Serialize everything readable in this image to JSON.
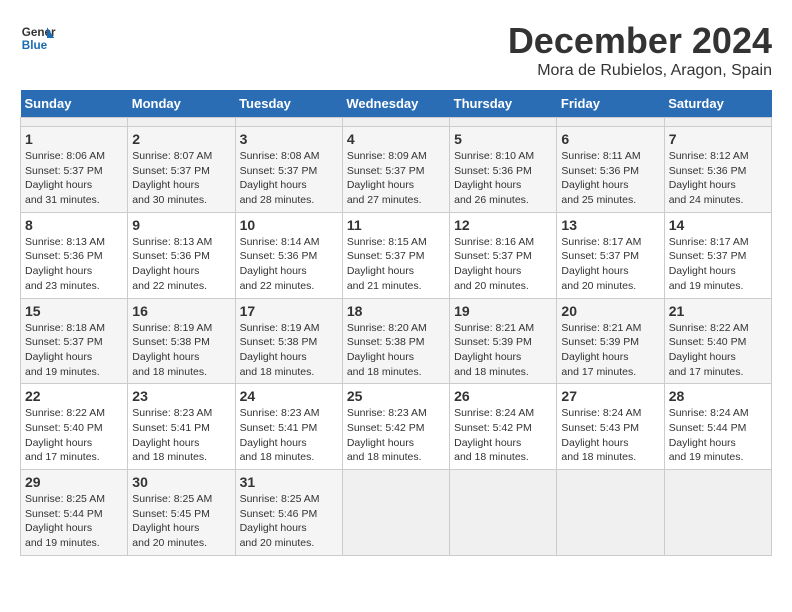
{
  "header": {
    "logo_line1": "General",
    "logo_line2": "Blue",
    "title": "December 2024",
    "subtitle": "Mora de Rubielos, Aragon, Spain"
  },
  "calendar": {
    "days_of_week": [
      "Sunday",
      "Monday",
      "Tuesday",
      "Wednesday",
      "Thursday",
      "Friday",
      "Saturday"
    ],
    "weeks": [
      [
        null,
        null,
        null,
        null,
        null,
        null,
        null
      ],
      [
        {
          "day": 1,
          "sunrise": "8:06 AM",
          "sunset": "5:37 PM",
          "daylight": "9 hours and 31 minutes."
        },
        {
          "day": 2,
          "sunrise": "8:07 AM",
          "sunset": "5:37 PM",
          "daylight": "9 hours and 30 minutes."
        },
        {
          "day": 3,
          "sunrise": "8:08 AM",
          "sunset": "5:37 PM",
          "daylight": "9 hours and 28 minutes."
        },
        {
          "day": 4,
          "sunrise": "8:09 AM",
          "sunset": "5:37 PM",
          "daylight": "9 hours and 27 minutes."
        },
        {
          "day": 5,
          "sunrise": "8:10 AM",
          "sunset": "5:36 PM",
          "daylight": "9 hours and 26 minutes."
        },
        {
          "day": 6,
          "sunrise": "8:11 AM",
          "sunset": "5:36 PM",
          "daylight": "9 hours and 25 minutes."
        },
        {
          "day": 7,
          "sunrise": "8:12 AM",
          "sunset": "5:36 PM",
          "daylight": "9 hours and 24 minutes."
        }
      ],
      [
        {
          "day": 8,
          "sunrise": "8:13 AM",
          "sunset": "5:36 PM",
          "daylight": "9 hours and 23 minutes."
        },
        {
          "day": 9,
          "sunrise": "8:13 AM",
          "sunset": "5:36 PM",
          "daylight": "9 hours and 22 minutes."
        },
        {
          "day": 10,
          "sunrise": "8:14 AM",
          "sunset": "5:36 PM",
          "daylight": "9 hours and 22 minutes."
        },
        {
          "day": 11,
          "sunrise": "8:15 AM",
          "sunset": "5:37 PM",
          "daylight": "9 hours and 21 minutes."
        },
        {
          "day": 12,
          "sunrise": "8:16 AM",
          "sunset": "5:37 PM",
          "daylight": "9 hours and 20 minutes."
        },
        {
          "day": 13,
          "sunrise": "8:17 AM",
          "sunset": "5:37 PM",
          "daylight": "9 hours and 20 minutes."
        },
        {
          "day": 14,
          "sunrise": "8:17 AM",
          "sunset": "5:37 PM",
          "daylight": "9 hours and 19 minutes."
        }
      ],
      [
        {
          "day": 15,
          "sunrise": "8:18 AM",
          "sunset": "5:37 PM",
          "daylight": "9 hours and 19 minutes."
        },
        {
          "day": 16,
          "sunrise": "8:19 AM",
          "sunset": "5:38 PM",
          "daylight": "9 hours and 18 minutes."
        },
        {
          "day": 17,
          "sunrise": "8:19 AM",
          "sunset": "5:38 PM",
          "daylight": "9 hours and 18 minutes."
        },
        {
          "day": 18,
          "sunrise": "8:20 AM",
          "sunset": "5:38 PM",
          "daylight": "9 hours and 18 minutes."
        },
        {
          "day": 19,
          "sunrise": "8:21 AM",
          "sunset": "5:39 PM",
          "daylight": "9 hours and 18 minutes."
        },
        {
          "day": 20,
          "sunrise": "8:21 AM",
          "sunset": "5:39 PM",
          "daylight": "9 hours and 17 minutes."
        },
        {
          "day": 21,
          "sunrise": "8:22 AM",
          "sunset": "5:40 PM",
          "daylight": "9 hours and 17 minutes."
        }
      ],
      [
        {
          "day": 22,
          "sunrise": "8:22 AM",
          "sunset": "5:40 PM",
          "daylight": "9 hours and 17 minutes."
        },
        {
          "day": 23,
          "sunrise": "8:23 AM",
          "sunset": "5:41 PM",
          "daylight": "9 hours and 18 minutes."
        },
        {
          "day": 24,
          "sunrise": "8:23 AM",
          "sunset": "5:41 PM",
          "daylight": "9 hours and 18 minutes."
        },
        {
          "day": 25,
          "sunrise": "8:23 AM",
          "sunset": "5:42 PM",
          "daylight": "9 hours and 18 minutes."
        },
        {
          "day": 26,
          "sunrise": "8:24 AM",
          "sunset": "5:42 PM",
          "daylight": "9 hours and 18 minutes."
        },
        {
          "day": 27,
          "sunrise": "8:24 AM",
          "sunset": "5:43 PM",
          "daylight": "9 hours and 18 minutes."
        },
        {
          "day": 28,
          "sunrise": "8:24 AM",
          "sunset": "5:44 PM",
          "daylight": "9 hours and 19 minutes."
        }
      ],
      [
        {
          "day": 29,
          "sunrise": "8:25 AM",
          "sunset": "5:44 PM",
          "daylight": "9 hours and 19 minutes."
        },
        {
          "day": 30,
          "sunrise": "8:25 AM",
          "sunset": "5:45 PM",
          "daylight": "9 hours and 20 minutes."
        },
        {
          "day": 31,
          "sunrise": "8:25 AM",
          "sunset": "5:46 PM",
          "daylight": "9 hours and 20 minutes."
        },
        null,
        null,
        null,
        null
      ]
    ]
  }
}
